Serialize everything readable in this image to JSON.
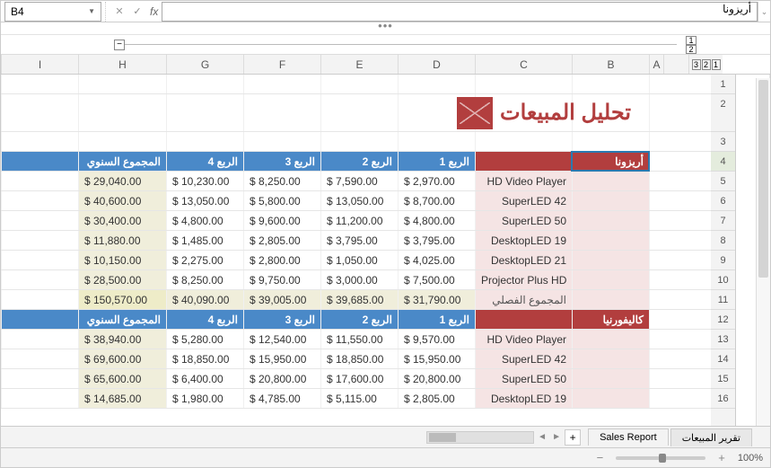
{
  "namebox": "B4",
  "formula_value": "أريزونا",
  "title": "تحليل المبيعات",
  "column_headers": [
    "I",
    "H",
    "G",
    "F",
    "E",
    "D",
    "C",
    "B",
    "A"
  ],
  "outline_levels_h": [
    "1",
    "2"
  ],
  "outline_levels_v": [
    "3",
    "2",
    "1"
  ],
  "row_numbers": [
    "1",
    "2",
    "3",
    "4",
    "5",
    "6",
    "7",
    "8",
    "9",
    "10",
    "11",
    "12",
    "13",
    "14",
    "15",
    "16"
  ],
  "states": {
    "arizona": {
      "name": "أريزونا",
      "subtotal_label": "المجموع الفصلي"
    },
    "california": {
      "name": "كاليفورنيا"
    }
  },
  "quarter_headers": {
    "q1": "الربع 1",
    "q2": "الربع 2",
    "q3": "الربع 3",
    "q4": "الربع 4",
    "annual": "المجموع السنوي"
  },
  "rows": [
    {
      "product": "HD Video Player",
      "d": "$ 2,970.00",
      "e": "$ 7,590.00",
      "f": "$ 8,250.00",
      "g": "$ 10,230.00",
      "h": "$ 29,040.00"
    },
    {
      "product": "SuperLED 42",
      "d": "$ 8,700.00",
      "e": "$ 13,050.00",
      "f": "$ 5,800.00",
      "g": "$ 13,050.00",
      "h": "$ 40,600.00"
    },
    {
      "product": "SuperLED 50",
      "d": "$ 4,800.00",
      "e": "$ 11,200.00",
      "f": "$ 9,600.00",
      "g": "$ 4,800.00",
      "h": "$ 30,400.00"
    },
    {
      "product": "DesktopLED 19",
      "d": "$ 3,795.00",
      "e": "$ 3,795.00",
      "f": "$ 2,805.00",
      "g": "$ 1,485.00",
      "h": "$ 11,880.00"
    },
    {
      "product": "DesktopLED 21",
      "d": "$ 4,025.00",
      "e": "$ 1,050.00",
      "f": "$ 2,800.00",
      "g": "$ 2,275.00",
      "h": "$ 10,150.00"
    },
    {
      "product": "Projector Plus HD",
      "d": "$ 7,500.00",
      "e": "$ 3,000.00",
      "f": "$ 9,750.00",
      "g": "$ 8,250.00",
      "h": "$ 28,500.00"
    }
  ],
  "subtotal": {
    "d": "$ 31,790.00",
    "e": "$ 39,685.00",
    "f": "$ 39,005.00",
    "g": "$ 40,090.00",
    "h": "$ 150,570.00"
  },
  "rows2": [
    {
      "product": "HD Video Player",
      "d": "$ 9,570.00",
      "e": "$ 11,550.00",
      "f": "$ 12,540.00",
      "g": "$ 5,280.00",
      "h": "$ 38,940.00"
    },
    {
      "product": "SuperLED 42",
      "d": "$ 15,950.00",
      "e": "$ 18,850.00",
      "f": "$ 15,950.00",
      "g": "$ 18,850.00",
      "h": "$ 69,600.00"
    },
    {
      "product": "SuperLED 50",
      "d": "$ 20,800.00",
      "e": "$ 17,600.00",
      "f": "$ 20,800.00",
      "g": "$ 6,400.00",
      "h": "$ 65,600.00"
    },
    {
      "product": "DesktopLED 19",
      "d": "$ 2,805.00",
      "e": "$ 5,115.00",
      "f": "$ 4,785.00",
      "g": "$ 1,980.00",
      "h": "$ 14,685.00"
    }
  ],
  "tabs": {
    "add": "+",
    "t1": "Sales Report",
    "t2": "تقرير المبيعات"
  },
  "zoom": "100%"
}
